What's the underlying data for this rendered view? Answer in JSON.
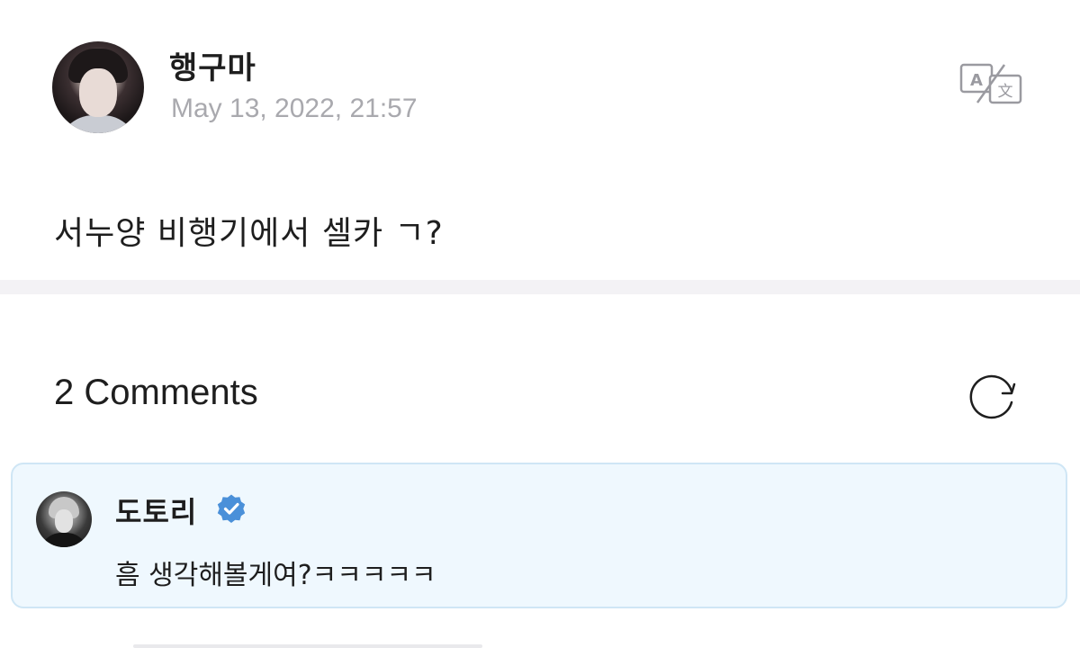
{
  "post": {
    "author": "행구마",
    "date": "May 13, 2022, 21:57",
    "text": "서누양 비행기에서 셀카 ㄱ?",
    "translate_icon": "translate-icon"
  },
  "comments": {
    "title": "2 Comments",
    "refresh_icon": "refresh-icon",
    "items": [
      {
        "author": "도토리",
        "verified": true,
        "text": "흠 생각해볼게여?ㅋㅋㅋㅋㅋ"
      }
    ]
  },
  "colors": {
    "verified": "#4a90d9",
    "comment_background": "#eff8fe",
    "comment_border": "#cfe6f5",
    "date_text": "#a9a9ae",
    "divider": "#f3f2f5"
  }
}
